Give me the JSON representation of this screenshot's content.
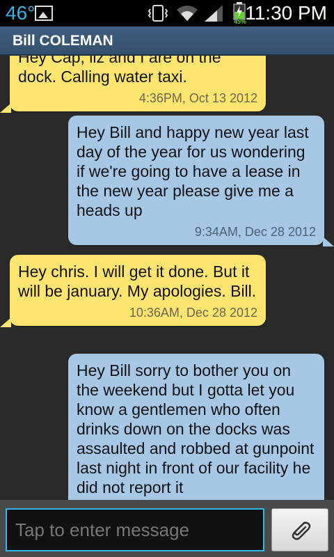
{
  "status_bar": {
    "temperature": "46°",
    "time": "11:30 PM",
    "battery_percent": "45%",
    "icons": [
      "gallery-icon",
      "vibrate-icon",
      "wifi-icon",
      "signal-icon",
      "battery-icon"
    ]
  },
  "header": {
    "contact_name": "Bill COLEMAN"
  },
  "messages": [
    {
      "direction": "incoming",
      "text": "Hey Cap, liz and I are on the dock.  Calling water taxi.",
      "timestamp": "4:36PM, Oct 13 2012"
    },
    {
      "direction": "outgoing",
      "text": "Hey Bill and happy new year last day of the year for us wondering if we're going to have a lease in the new year please give me a heads up",
      "timestamp": "9:34AM, Dec 28 2012"
    },
    {
      "direction": "incoming",
      "text": "Hey chris.  I will get it done. But it will be january.  My apologies. Bill.",
      "timestamp": "10:36AM, Dec 28 2012"
    },
    {
      "direction": "outgoing",
      "text": "Hey Bill sorry to bother you on the weekend but I gotta let you know a gentlemen who often drinks down on the docks was assaulted and robbed at gunpoint last night in front of our facility he did not report it",
      "timestamp": ""
    }
  ],
  "composer": {
    "placeholder": "Tap to enter message",
    "value": ""
  },
  "colors": {
    "incoming_bubble": "#fde570",
    "outgoing_bubble": "#a6c7e6",
    "accent": "#33b5e5"
  }
}
